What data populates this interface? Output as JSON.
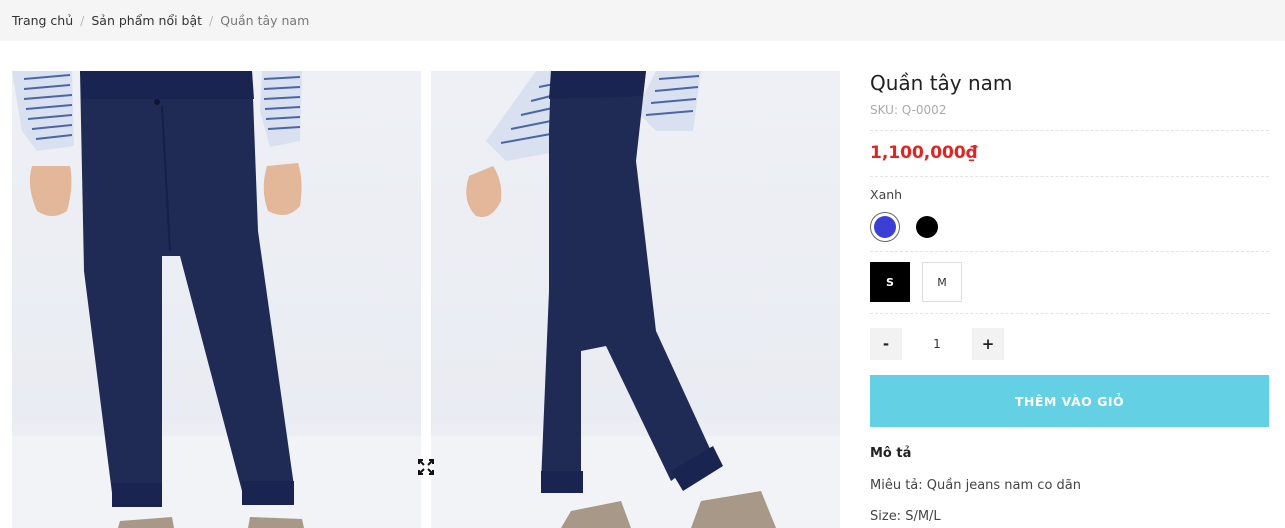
{
  "breadcrumb": {
    "items": [
      "Trang chủ",
      "Sản phẩm nổi bật"
    ],
    "current": "Quần tây nam",
    "separator": "/"
  },
  "gallery": {
    "expand_icon": "expand-arrows-icon"
  },
  "product": {
    "title": "Quần tây nam",
    "sku": "SKU: Q-0002",
    "price": "1,100,000₫",
    "color_label": "Xanh",
    "colors": [
      {
        "name": "Xanh",
        "hex": "#3c3fd6",
        "selected": true
      },
      {
        "name": "Đen",
        "hex": "#000000",
        "selected": false
      }
    ],
    "sizes": [
      {
        "label": "S",
        "selected": true
      },
      {
        "label": "M",
        "selected": false
      }
    ],
    "quantity": {
      "minus": "-",
      "value": "1",
      "plus": "+"
    },
    "add_to_cart": "THÊM VÀO GIỎ",
    "description": {
      "heading": "Mô tả",
      "lines": [
        "Miêu tả: Quần jeans nam co dãn",
        "Size: S/M/L"
      ]
    }
  },
  "colors": {
    "accent": "#63d0e4",
    "price": "#e32222",
    "breadcrumb_bg": "#f5f5f5"
  }
}
